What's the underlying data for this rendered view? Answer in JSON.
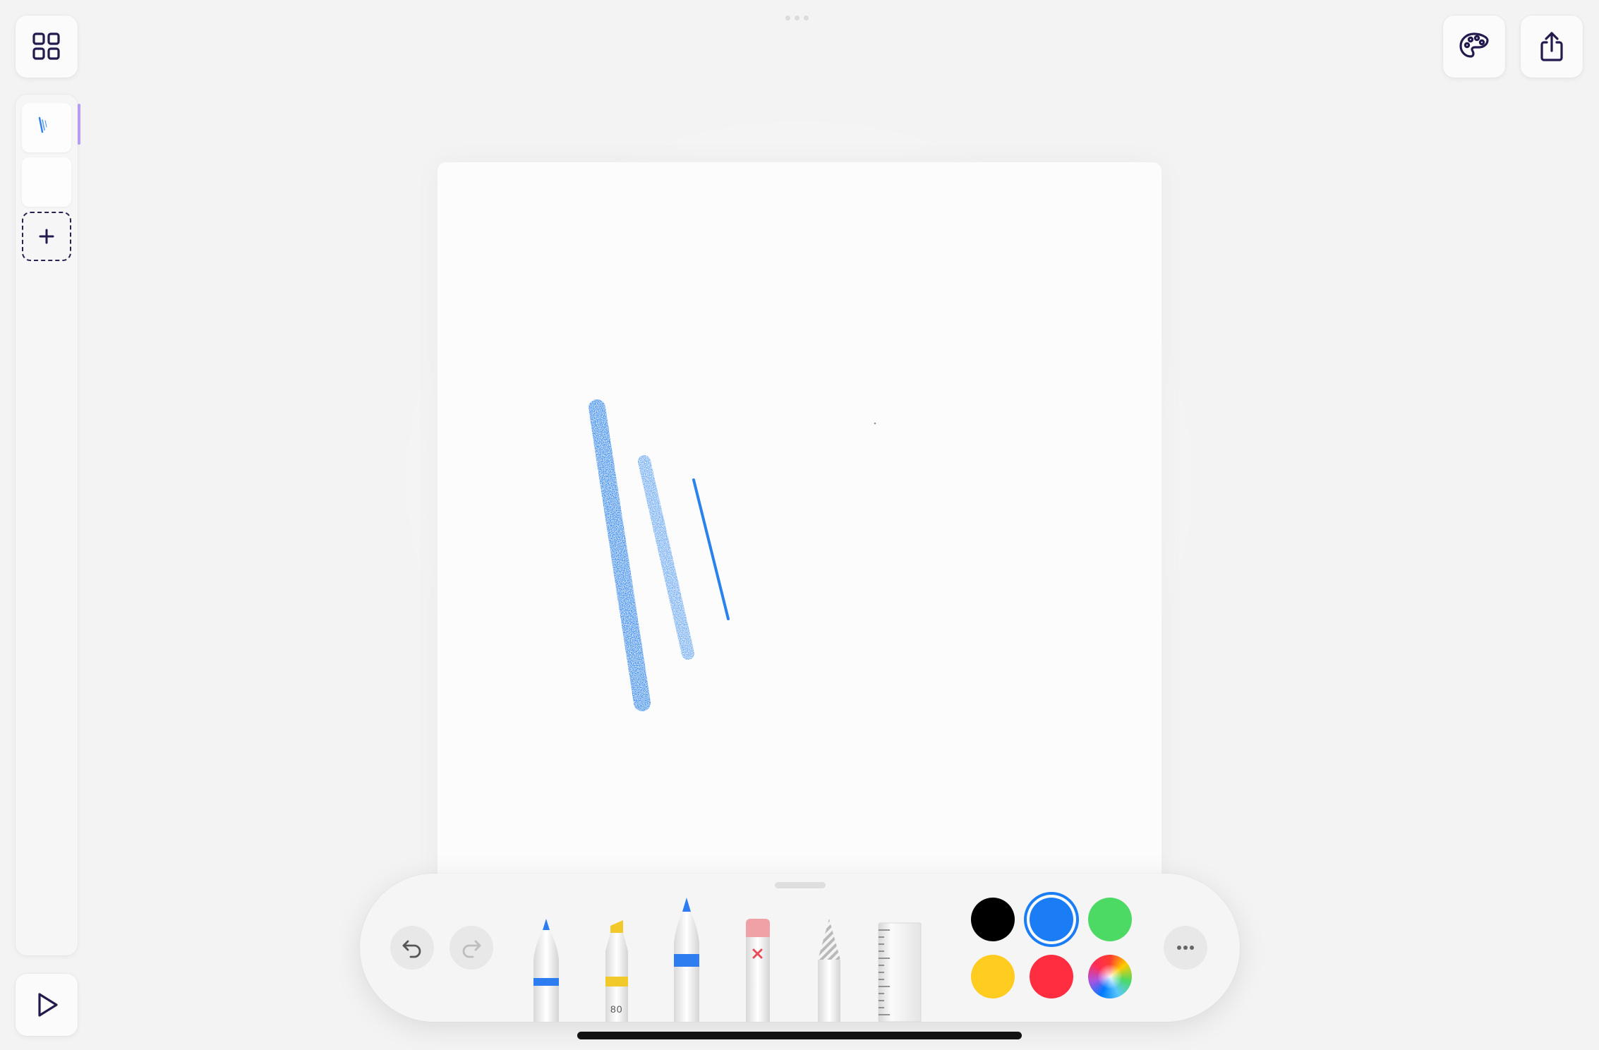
{
  "top_bar": {
    "gallery_icon": "grid-icon",
    "palette_icon": "palette-icon",
    "share_icon": "share-icon"
  },
  "sidebar": {
    "pages": [
      {
        "name": "page-1",
        "selected": true
      },
      {
        "name": "page-2",
        "selected": false
      }
    ],
    "add_icon": "plus-icon",
    "play_icon": "play-icon"
  },
  "toolbar": {
    "undo_icon": "undo-icon",
    "redo_icon": "redo-icon",
    "tools": [
      {
        "name": "pen",
        "band_color": "#2e7df0"
      },
      {
        "name": "marker",
        "band_color": "#f2c92b",
        "label": "80"
      },
      {
        "name": "pencil",
        "band_color": "#2e7df0",
        "selected": true
      },
      {
        "name": "eraser",
        "tip_color": "#f0a1a6"
      },
      {
        "name": "lasso"
      },
      {
        "name": "ruler"
      }
    ],
    "colors": [
      {
        "name": "black",
        "hex": "#000000"
      },
      {
        "name": "blue",
        "hex": "#1a7df6",
        "selected": true
      },
      {
        "name": "green",
        "hex": "#4cd964"
      },
      {
        "name": "yellow",
        "hex": "#ffcc1f"
      },
      {
        "name": "red",
        "hex": "#ff2d3f"
      },
      {
        "name": "multicolor",
        "hex": "conic"
      }
    ],
    "more_icon": "more-icon"
  },
  "accent_colors": {
    "ink": "#1f7be8",
    "active_page_indicator": "#b69cf2",
    "icon_stroke": "#231a4d"
  }
}
